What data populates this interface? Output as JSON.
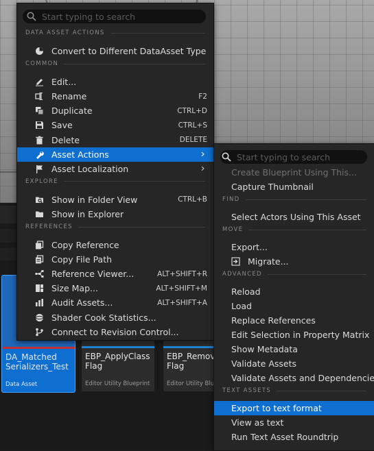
{
  "main_menu": {
    "search": {
      "placeholder": "Start typing to search"
    },
    "sections": [
      {
        "label": "DATA ASSET ACTIONS",
        "items": [
          {
            "label": "Convert to Different DataAsset Type",
            "icon": "pie-chart-icon"
          }
        ]
      },
      {
        "label": "COMMON",
        "items": [
          {
            "label": "Edit...",
            "icon": "pencil-icon"
          },
          {
            "label": "Rename",
            "icon": "rename-icon",
            "shortcut": "F2"
          },
          {
            "label": "Duplicate",
            "icon": "duplicate-icon",
            "shortcut": "CTRL+D"
          },
          {
            "label": "Save",
            "icon": "save-icon",
            "shortcut": "CTRL+S"
          },
          {
            "label": "Delete",
            "icon": "trash-icon",
            "shortcut": "DELETE"
          },
          {
            "label": "Asset Actions",
            "icon": "wrench-icon",
            "submenu": true,
            "highlighted": true
          },
          {
            "label": "Asset Localization",
            "icon": "flag-icon",
            "submenu": true
          }
        ]
      },
      {
        "label": "EXPLORE",
        "items": [
          {
            "label": "Show in Folder View",
            "icon": "folder-search-icon",
            "shortcut": "CTRL+B"
          },
          {
            "label": "Show in Explorer",
            "icon": "folder-icon"
          }
        ]
      },
      {
        "label": "REFERENCES",
        "items": [
          {
            "label": "Copy Reference",
            "icon": "copy-icon"
          },
          {
            "label": "Copy File Path",
            "icon": "copy-path-icon"
          },
          {
            "label": "Reference Viewer...",
            "icon": "graph-icon",
            "shortcut": "ALT+SHIFT+R"
          },
          {
            "label": "Size Map...",
            "icon": "size-map-icon",
            "shortcut": "ALT+SHIFT+M"
          },
          {
            "label": "Audit Assets...",
            "icon": "audit-icon",
            "shortcut": "ALT+SHIFT+A"
          },
          {
            "label": "Shader Cook Statistics...",
            "icon": "sphere-icon"
          },
          {
            "label": "Connect to Revision Control...",
            "icon": "branch-icon"
          }
        ]
      }
    ]
  },
  "sub_menu": {
    "search": {
      "placeholder": "Start typing to search"
    },
    "sections": [
      {
        "label": "",
        "items": [
          {
            "label": "Create Blueprint Using This...",
            "disabled": true
          },
          {
            "label": "Capture Thumbnail"
          }
        ]
      },
      {
        "label": "FIND",
        "items": [
          {
            "label": "Select Actors Using This Asset"
          }
        ]
      },
      {
        "label": "MOVE",
        "items": [
          {
            "label": "Export..."
          },
          {
            "label": "Migrate...",
            "icon": "migrate-icon"
          }
        ]
      },
      {
        "label": "ADVANCED",
        "items": [
          {
            "label": "Reload"
          },
          {
            "label": "Load"
          },
          {
            "label": "Replace References"
          },
          {
            "label": "Edit Selection in Property Matrix"
          },
          {
            "label": "Show Metadata"
          },
          {
            "label": "Validate Assets"
          },
          {
            "label": "Validate Assets and Dependencies"
          }
        ]
      },
      {
        "label": "TEXT ASSETS",
        "items": [
          {
            "label": "Export to text format",
            "highlighted": true
          },
          {
            "label": "View as text"
          },
          {
            "label": "Run Text Asset Roundtrip"
          }
        ]
      }
    ]
  },
  "assets": [
    {
      "name": "DA_Matched\nSerializers_Test",
      "type": "Data Asset",
      "selected": true
    },
    {
      "name": "EBP_ApplyClass\nFlag",
      "type": "Editor Utility Blueprint"
    },
    {
      "name": "EBP_Remove\nFlag",
      "type": "Editor Utility Blueprint"
    }
  ],
  "colors": {
    "highlight": "#0f6fd0",
    "menu_bg": "#262626",
    "asset_accent": "#1e86d6"
  }
}
